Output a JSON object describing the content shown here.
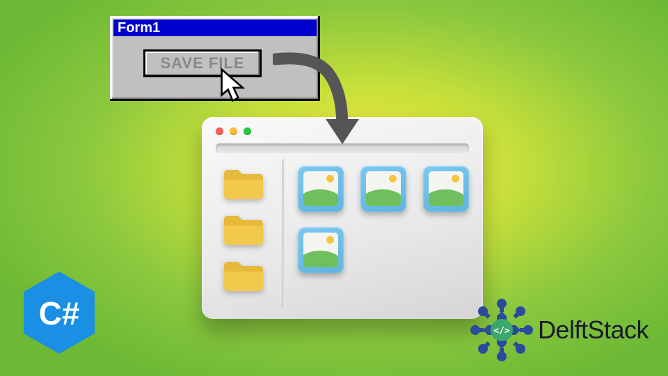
{
  "form": {
    "title": "Form1",
    "save_button_label": "SAVE FILE"
  },
  "explorer": {
    "folder_count": 3,
    "image_count": 4
  },
  "badges": {
    "csharp_label": "C#",
    "brand_name": "DelftStack"
  },
  "colors": {
    "titlebar": "#0000cc",
    "csharp_hex": "#1a8fe3",
    "folder": "#f2c94c",
    "thumb_frame": "#5db4e0",
    "delft_blue": "#2a4b9b",
    "delft_green": "#3aa76d"
  }
}
